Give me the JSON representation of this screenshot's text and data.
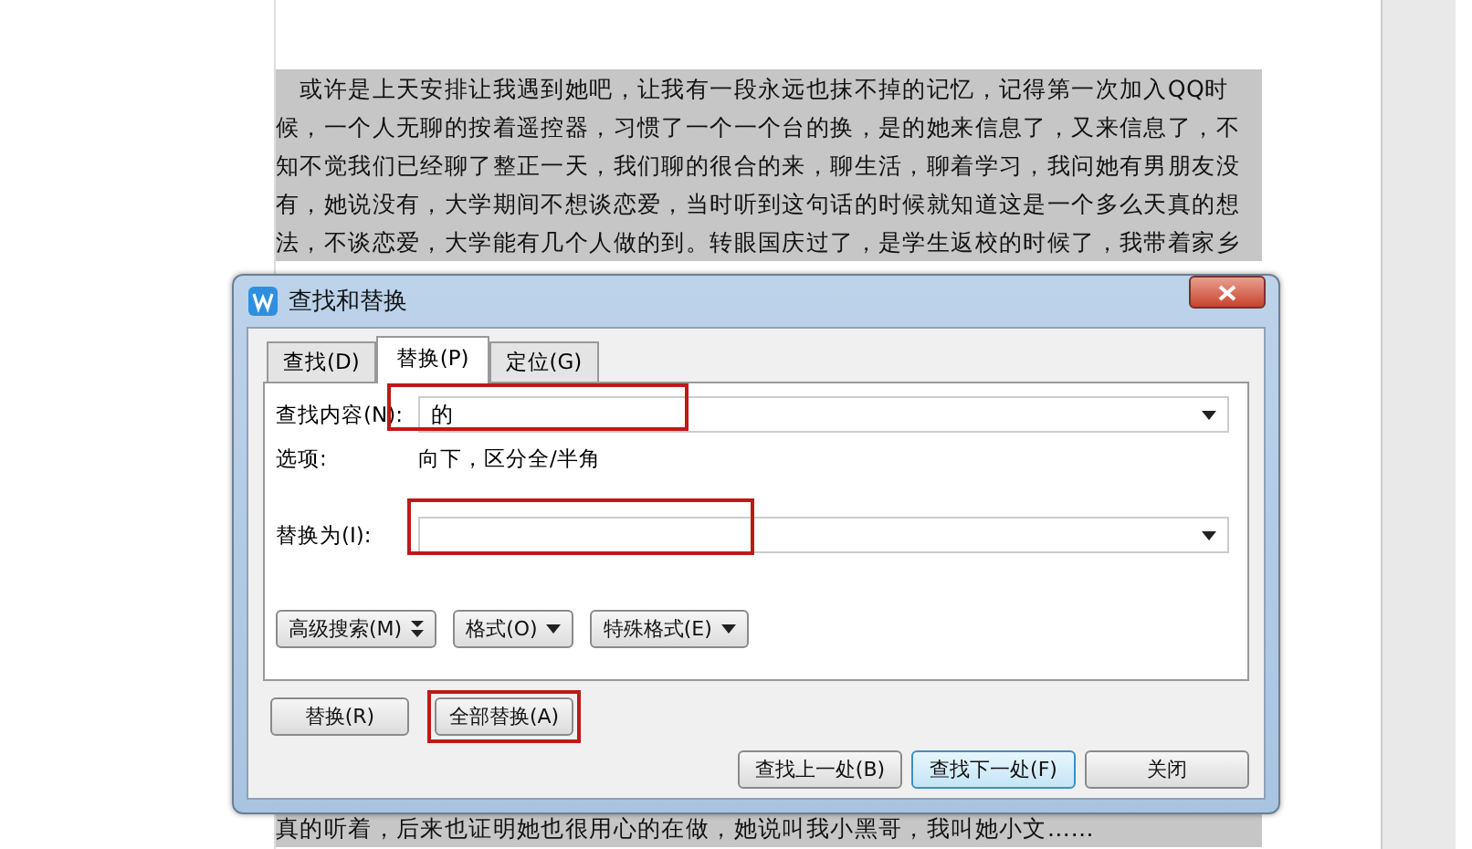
{
  "document": {
    "top_lines": [
      "　或许是上天安排让我遇到她吧，让我有一段永远也抹不掉的记忆，记得第一次加入QQ时",
      "候，一个人无聊的按着遥控器，习惯了一个一个台的换，是的她来信息了，又来信息了，不",
      "知不觉我们已经聊了整正一天，我们聊的很合的来，聊生活，聊着学习，我问她有男朋友没",
      "有，她说没有，大学期间不想谈恋爱，当时听到这句话的时候就知道这是一个多么天真的想",
      "法，不谈恋爱，大学能有几个人做的到。转眼国庆过了，是学生返校的时候了，我带着家乡"
    ],
    "bottom_lines": [
      "真的听着，后来也证明她也很用心的在做，她说叫我小黑哥，我叫她小文……"
    ]
  },
  "dialog": {
    "title": "查找和替换",
    "tabs": [
      {
        "label": "查找(D)",
        "selected": false
      },
      {
        "label": "替换(P)",
        "selected": true
      },
      {
        "label": "定位(G)",
        "selected": false
      }
    ],
    "find": {
      "label": "查找内容(N):",
      "value": "的"
    },
    "options": {
      "label": "选项:",
      "value": "向下，区分全/半角"
    },
    "replace": {
      "label": "替换为(I):"
    },
    "option_buttons": [
      {
        "label": "高级搜索(M)",
        "kind": "double"
      },
      {
        "label": "格式(O)",
        "kind": "single"
      },
      {
        "label": "特殊格式(E)",
        "kind": "single"
      }
    ],
    "replace_buttons": [
      {
        "label": "替换(R)",
        "highlighted": false
      },
      {
        "label": "全部替换(A)",
        "highlighted": true
      }
    ],
    "nav_buttons": [
      {
        "label": "查找上一处(B)",
        "focused": false
      },
      {
        "label": "查找下一处(F)",
        "focused": true
      },
      {
        "label": "关闭",
        "focused": false
      }
    ],
    "annotations": {
      "find_field": true,
      "replace_field": true
    }
  }
}
